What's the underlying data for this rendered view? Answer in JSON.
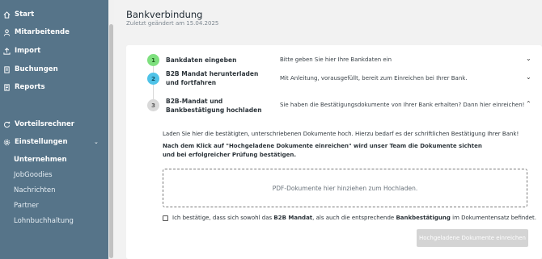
{
  "sidebar": {
    "items": [
      {
        "label": "Start",
        "icon": "home-icon"
      },
      {
        "label": "Mitarbeitende",
        "icon": "user-icon"
      },
      {
        "label": "Import",
        "icon": "upload-icon"
      },
      {
        "label": "Buchungen",
        "icon": "bookings-icon"
      },
      {
        "label": "Reports",
        "icon": "reports-icon"
      }
    ],
    "group2": [
      {
        "label": "Vorteilsrechner",
        "icon": "refresh-icon"
      },
      {
        "label": "Einstellungen",
        "icon": "gear-icon"
      }
    ],
    "submenu": [
      {
        "label": "Unternehmen",
        "active": true
      },
      {
        "label": "JobGoodies",
        "active": false
      },
      {
        "label": "Nachrichten",
        "active": false
      },
      {
        "label": "Partner",
        "active": false
      },
      {
        "label": "Lohnbuchhaltung",
        "active": false
      }
    ]
  },
  "header": {
    "title": "Bankverbindung",
    "subtitle": "Zuletzt geändert am 15.04.2025"
  },
  "steps": [
    {
      "number": "1",
      "title": "Bankdaten eingeben",
      "desc": "Bitte geben Sie hier Ihre Bankdaten ein",
      "color": "#7ee07e",
      "state": "done"
    },
    {
      "number": "2",
      "title": "B2B Mandat herunterladen und fortfahren",
      "desc": "Mit Anleitung, vorausgefüllt, bereit zum Einreichen bei Ihrer Bank.",
      "color": "#4fc3e8",
      "state": "active"
    },
    {
      "number": "3",
      "title": "B2B-Mandat und Bankbestätigung hochladen",
      "desc": "Sie haben die Bestätigungsdokumente von Ihrer Bank erhalten? Dann hier einreichen!",
      "color": "#d9d9d9",
      "state": "pending"
    }
  ],
  "upload": {
    "intro": "Laden Sie hier die bestätigten, unterschriebenen Dokumente hoch. Hierzu bedarf es der schriftlichen Bestätigung Ihrer Bank!",
    "note": "Nach dem Klick auf \"Hochgeladene Dokumente einreichen\" wird unser Team die Dokumente sichten und bei erfolgreicher Prüfung bestätigen.",
    "dropzone": "PDF-Dokumente hier hinziehen zum Hochladen.",
    "confirm_pre": "Ich bestätige, dass sich sowohl das ",
    "confirm_b1": "B2B Mandat",
    "confirm_mid": ", als auch die entsprechende ",
    "confirm_b2": "Bankbestätigung",
    "confirm_post": " im Dokumentensatz befindet.",
    "submit": "Hochgeladene Dokumente einreichen"
  }
}
